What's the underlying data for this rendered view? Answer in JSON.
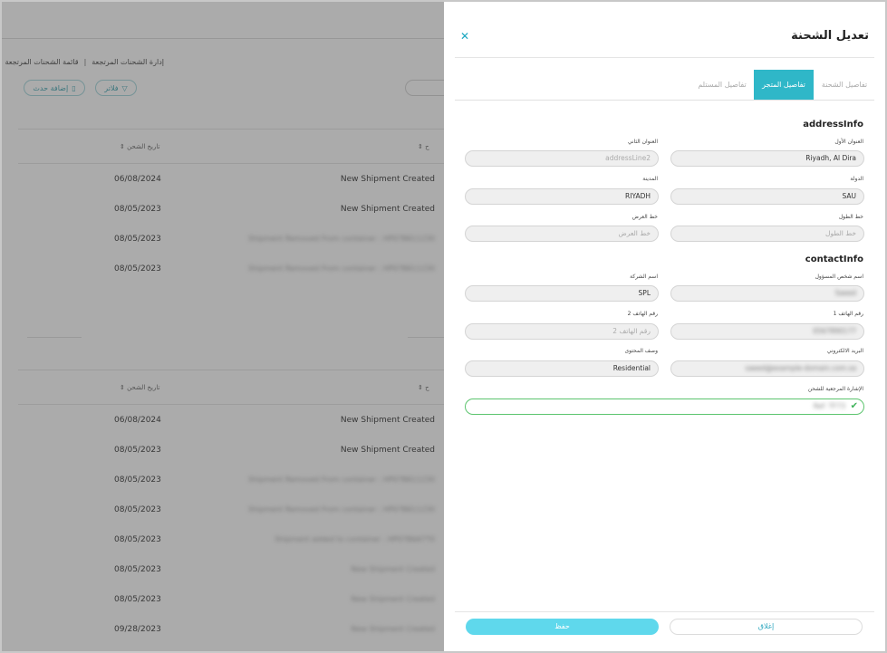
{
  "background": {
    "breadcrumb": {
      "parent": "إدارة الشحنات المرتجعة",
      "current": "قائمة الشحنات المرتجعة"
    },
    "toolbar": {
      "filter_label": "فلاتر",
      "add_event_label": "إضافة حدث"
    },
    "table_headers": {
      "event": "ح",
      "date": "تاريخ الشحن"
    },
    "table1_rows": [
      {
        "date": "06/08/2024",
        "event": "New Shipment Created"
      },
      {
        "date": "08/05/2023",
        "event": "New Shipment Created"
      },
      {
        "date": "08/05/2023",
        "event": "Shipment Removed From container : HP07B611230"
      },
      {
        "date": "08/05/2023",
        "event": "Shipment Removed From container : HP07B611230"
      }
    ],
    "table2_rows": [
      {
        "date": "06/08/2024",
        "event": "New Shipment Created"
      },
      {
        "date": "08/05/2023",
        "event": "New Shipment Created"
      },
      {
        "date": "08/05/2023",
        "event": "Shipment Removed From container : HP07B611230"
      },
      {
        "date": "08/05/2023",
        "event": "Shipment Removed From container : HP07B611230"
      },
      {
        "date": "08/05/2023",
        "event": "Shipment added to container : HP07B6A7T0"
      },
      {
        "date": "08/05/2023",
        "event": "New Shipment Created"
      },
      {
        "date": "08/05/2023",
        "event": "New Shipment Created"
      },
      {
        "date": "09/28/2023",
        "event": "New Shipment Created"
      }
    ]
  },
  "drawer": {
    "title": "تعديل الشحنة",
    "tabs": [
      {
        "label": "تفاصيل الشحنة",
        "active": false
      },
      {
        "label": "تفاصيل المتجر",
        "active": true
      },
      {
        "label": "تفاصيل المستلم",
        "active": false
      }
    ],
    "address_section": {
      "title": "addressInfo",
      "address1": {
        "label": "العنوان الأول",
        "value": "Riyadh, Al Dira"
      },
      "address2": {
        "label": "العنوان الثاني",
        "placeholder": "addressLine2"
      },
      "country": {
        "label": "الدولة",
        "value": "SAU"
      },
      "city": {
        "label": "المدينة",
        "value": "RIYADH"
      },
      "longitude": {
        "label": "خط الطول",
        "placeholder": "خط الطول"
      },
      "latitude": {
        "label": "خط العرض",
        "placeholder": "خط العرض"
      }
    },
    "contact_section": {
      "title": "contactInfo",
      "contact_person": {
        "label": "اسم شخص المسؤول",
        "value": "Saeed"
      },
      "company": {
        "label": "اسم الشركة",
        "value": "SPL"
      },
      "phone1": {
        "label": "رقم الهاتف 1",
        "value": "0567890177"
      },
      "phone2": {
        "label": "رقم الهاتف 2",
        "placeholder": "رقم الهاتف 2"
      },
      "email": {
        "label": "البريد الالكتروني",
        "value": "saeed@example-domain.com.sa"
      },
      "content": {
        "label": "وصف المحتوى",
        "value": "Residential"
      },
      "reference": {
        "label": "الإشارة المرجعية للشحن",
        "value": "Ref: TF73"
      }
    },
    "buttons": {
      "save": "حفظ",
      "close": "إغلاق"
    }
  },
  "colors": {
    "accent": "#2fb7c8",
    "save_button": "#5fd8ec",
    "valid": "#5cc46e"
  }
}
